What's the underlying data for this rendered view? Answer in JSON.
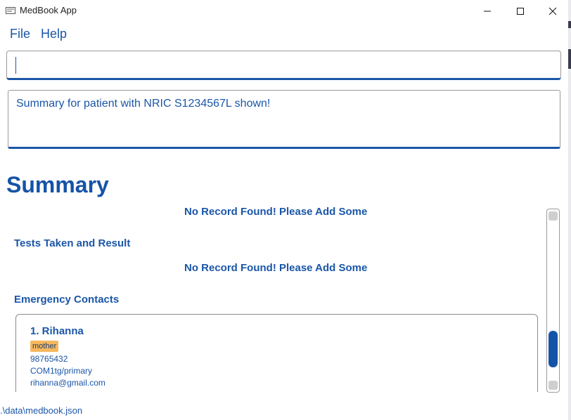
{
  "window": {
    "title": "MedBook App",
    "icon": "app-window-icon",
    "controls": [
      "minimize-icon",
      "maximize-icon",
      "close-icon"
    ]
  },
  "menu": {
    "items": [
      {
        "label": "File"
      },
      {
        "label": "Help"
      }
    ]
  },
  "command_box": {
    "value": ""
  },
  "result": {
    "message": "Summary for patient with NRIC S1234567L shown!"
  },
  "summary": {
    "heading": "Summary",
    "no_record_message": "No Record Found! Please Add Some",
    "tests_title": "Tests Taken and Result",
    "emergency_title": "Emergency Contacts",
    "contacts": [
      {
        "index_name": "1.  Rihanna",
        "tag": "mother",
        "phone": "98765432",
        "address": "COM1tg/primary",
        "email": "rihanna@gmail.com"
      }
    ]
  },
  "status_bar": {
    "path": ".\\data\\medbook.json"
  },
  "colors": {
    "accent": "#1a56a8",
    "heading": "#1553a8",
    "tag": "#f5b85c"
  }
}
